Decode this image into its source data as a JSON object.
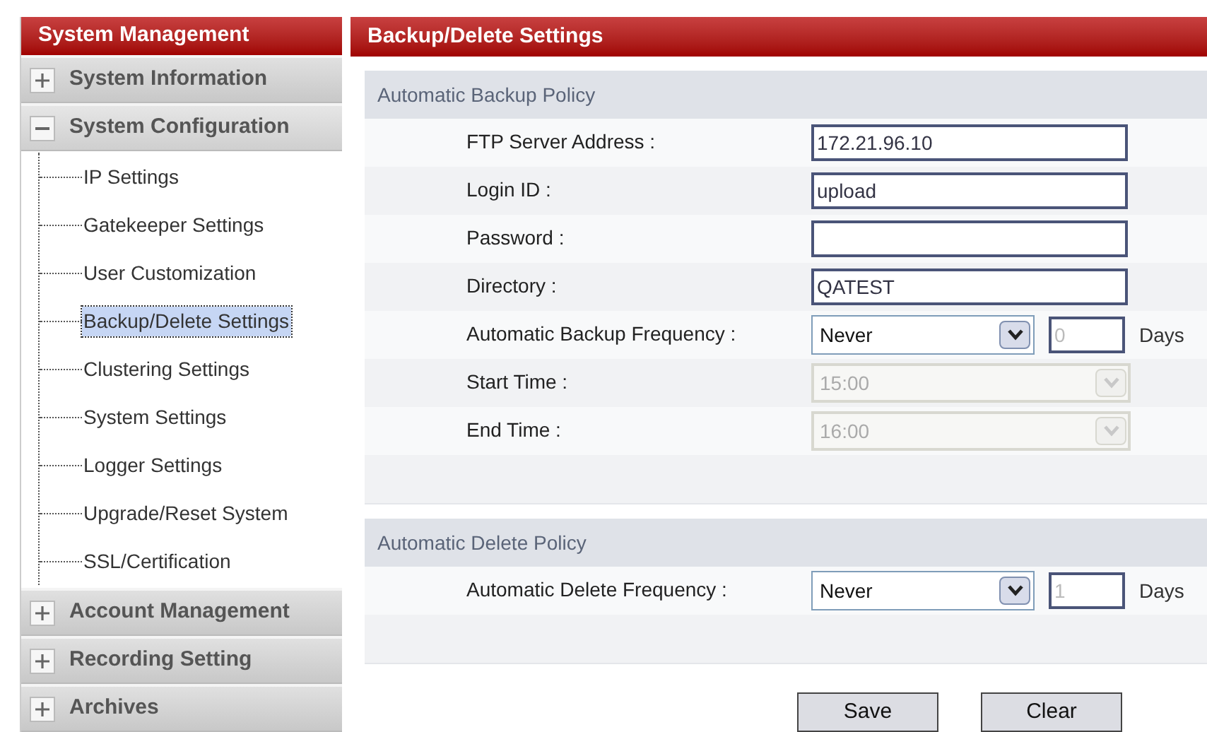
{
  "sidebar": {
    "title": "System Management",
    "groups": [
      {
        "label": "System Information",
        "expanded": false
      },
      {
        "label": "System Configuration",
        "expanded": true,
        "children": [
          {
            "label": "IP Settings",
            "selected": false
          },
          {
            "label": "Gatekeeper Settings",
            "selected": false
          },
          {
            "label": "User Customization",
            "selected": false
          },
          {
            "label": "Backup/Delete Settings",
            "selected": true
          },
          {
            "label": "Clustering Settings",
            "selected": false
          },
          {
            "label": "System Settings",
            "selected": false
          },
          {
            "label": "Logger Settings",
            "selected": false
          },
          {
            "label": "Upgrade/Reset System",
            "selected": false
          },
          {
            "label": "SSL/Certification",
            "selected": false
          }
        ]
      },
      {
        "label": "Account Management",
        "expanded": false
      },
      {
        "label": "Recording Setting",
        "expanded": false
      },
      {
        "label": "Archives",
        "expanded": false
      }
    ]
  },
  "main": {
    "title": "Backup/Delete Settings",
    "sections": [
      {
        "title": "Automatic Backup Policy",
        "rows": [
          {
            "kind": "text",
            "label": "FTP Server Address :",
            "value": "172.21.96.10"
          },
          {
            "kind": "text",
            "label": "Login ID :",
            "value": "upload"
          },
          {
            "kind": "text",
            "label": "Password :"
          },
          {
            "kind": "text",
            "label": "Directory :",
            "value": "QATEST"
          },
          {
            "kind": "select_days",
            "label": "Automatic Backup Frequency :",
            "value": "Never",
            "days": "0",
            "days_disabled": true,
            "unit": "Days"
          },
          {
            "kind": "select",
            "label": "Start Time :",
            "value": "15:00",
            "disabled": true
          },
          {
            "kind": "select",
            "label": "End Time :",
            "value": "16:00",
            "disabled": true
          }
        ]
      },
      {
        "title": "Automatic Delete Policy",
        "rows": [
          {
            "kind": "select_days",
            "label": "Automatic Delete Frequency :",
            "value": "Never",
            "days": "1",
            "days_disabled": true,
            "unit": "Days"
          }
        ]
      }
    ],
    "buttons": [
      "Save",
      "Clear"
    ]
  }
}
